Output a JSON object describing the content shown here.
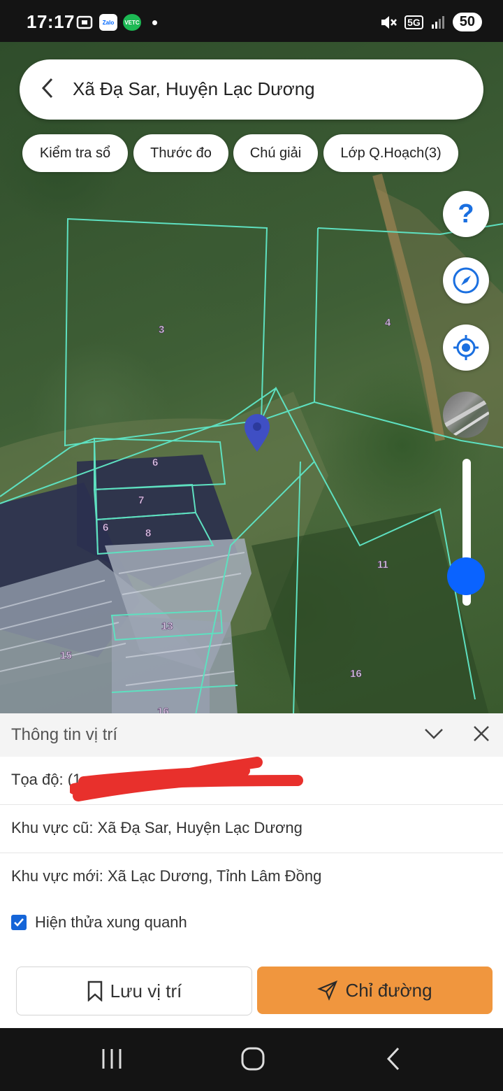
{
  "status_bar": {
    "time": "17:17",
    "battery": "50",
    "network": "5G",
    "notification_icons": [
      "screenshot-icon",
      "zalo-icon",
      "vetc-icon",
      "dot-icon"
    ],
    "zalo_label": "Zalo",
    "vetc_label": "VETC"
  },
  "header": {
    "location_title": "Xã Đạ Sar, Huyện Lạc Dương"
  },
  "toolbar": {
    "chips": [
      "Kiểm tra sổ",
      "Thước đo",
      "Chú giải",
      "Lớp Q.Hoạch(3)"
    ]
  },
  "map": {
    "parcel_labels": [
      "3",
      "4",
      "6",
      "7",
      "6",
      "8",
      "11",
      "13",
      "15",
      "16",
      "16"
    ],
    "boundary_color": "#5ee0c0",
    "marker_color": "#3f4fc4"
  },
  "map_controls": {
    "help_glyph": "?",
    "icons": [
      "help-icon",
      "compass-icon",
      "my-location-icon",
      "map-layer-icon"
    ],
    "zoom_level": 0.2
  },
  "info_panel": {
    "title": "Thông tin vị trí",
    "coordinates_label": "Tọa độ: (1",
    "coordinates_fragment": "08",
    "old_area": "Khu vực cũ: Xã Đạ Sar, Huyện Lạc Dương",
    "new_area": "Khu vực mới: Xã Lạc Dương, Tỉnh Lâm Đồng",
    "show_neighbors_label": "Hiện thửa xung quanh",
    "show_neighbors_checked": true
  },
  "actions": {
    "save_label": "Lưu vị trí",
    "directions_label": "Chỉ đường",
    "directions_color": "#f0963e"
  },
  "nav_bar": {
    "icons": [
      "recents-icon",
      "home-icon",
      "back-icon"
    ]
  }
}
